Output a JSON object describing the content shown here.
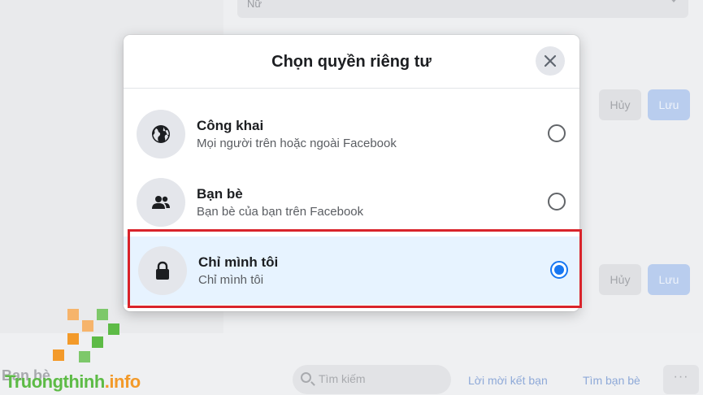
{
  "background": {
    "gender_select_value": "Nữ",
    "cancel_label": "Hủy",
    "save_label": "Lưu",
    "footer_title": "Bạn bè",
    "search_placeholder": "Tìm kiếm",
    "friend_requests_link": "Lời mời kết bạn",
    "find_friends_link": "Tìm bạn bè",
    "more_label": "···"
  },
  "modal": {
    "title": "Chọn quyền riêng tư",
    "options": [
      {
        "label": "Công khai",
        "description": "Mọi người trên hoặc ngoài Facebook",
        "icon": "globe-icon",
        "selected": false
      },
      {
        "label": "Bạn bè",
        "description": "Bạn bè của bạn trên Facebook",
        "icon": "friends-icon",
        "selected": false
      },
      {
        "label": "Chỉ mình tôi",
        "description": "Chỉ mình tôi",
        "icon": "lock-icon",
        "selected": true
      }
    ]
  },
  "watermark": {
    "brand_part1": "Truongthinh",
    "brand_part2": ".info"
  },
  "colors": {
    "accent": "#1877f2",
    "highlight": "#d9242b",
    "selected_bg": "#e7f3ff"
  }
}
